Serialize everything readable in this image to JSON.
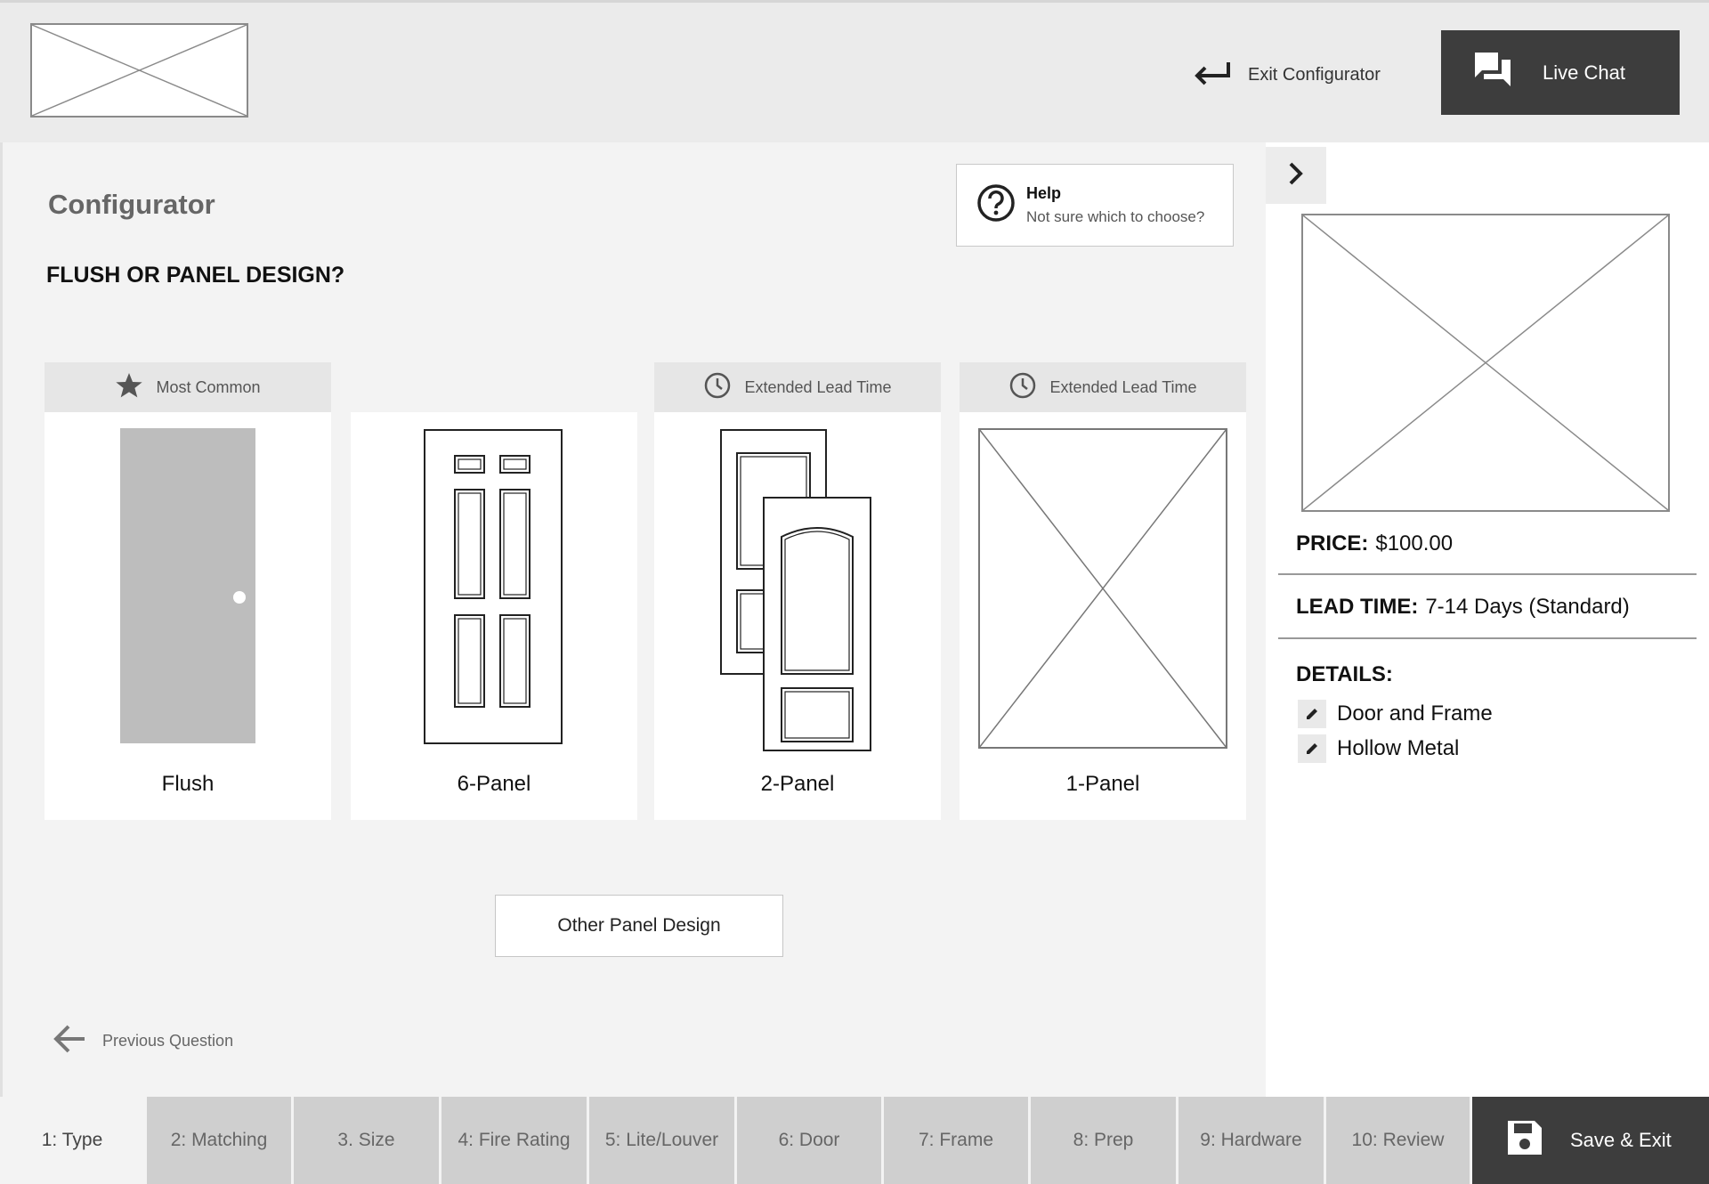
{
  "header": {
    "logo_icon": "image-placeholder-icon",
    "exit_label": "Exit Configurator",
    "live_chat_label": "Live Chat"
  },
  "main": {
    "title": "Configurator",
    "question": "FLUSH OR PANEL DESIGN?",
    "help": {
      "title": "Help",
      "subtitle": "Not sure which to choose?"
    },
    "options": [
      {
        "tag": "Most Common",
        "tag_icon": "star-icon",
        "name": "Flush"
      },
      {
        "tag": "",
        "tag_icon": "",
        "name": "6-Panel"
      },
      {
        "tag": "Extended Lead Time",
        "tag_icon": "clock-icon",
        "name": "2-Panel"
      },
      {
        "tag": "Extended Lead Time",
        "tag_icon": "clock-icon",
        "name": "1-Panel"
      }
    ],
    "other_button": "Other Panel Design",
    "previous_label": "Previous Question"
  },
  "side": {
    "price_label": "PRICE:",
    "price_value": "$100.00",
    "lead_label": "LEAD TIME:",
    "lead_value": "7-14 Days (Standard)",
    "details_title": "DETAILS:",
    "details": [
      "Door and Frame",
      "Hollow Metal"
    ]
  },
  "steps": [
    "1: Type",
    "2: Matching",
    "3. Size",
    "4: Fire Rating",
    "5: Lite/Louver",
    "6: Door",
    "7: Frame",
    "8: Prep",
    "9: Hardware",
    "10: Review"
  ],
  "active_step": "1: Type",
  "save_exit_label": "Save & Exit",
  "colors": {
    "dark": "#3d3d3d",
    "flush_door": "#bdbdbd",
    "background": "#f3f3f3"
  }
}
